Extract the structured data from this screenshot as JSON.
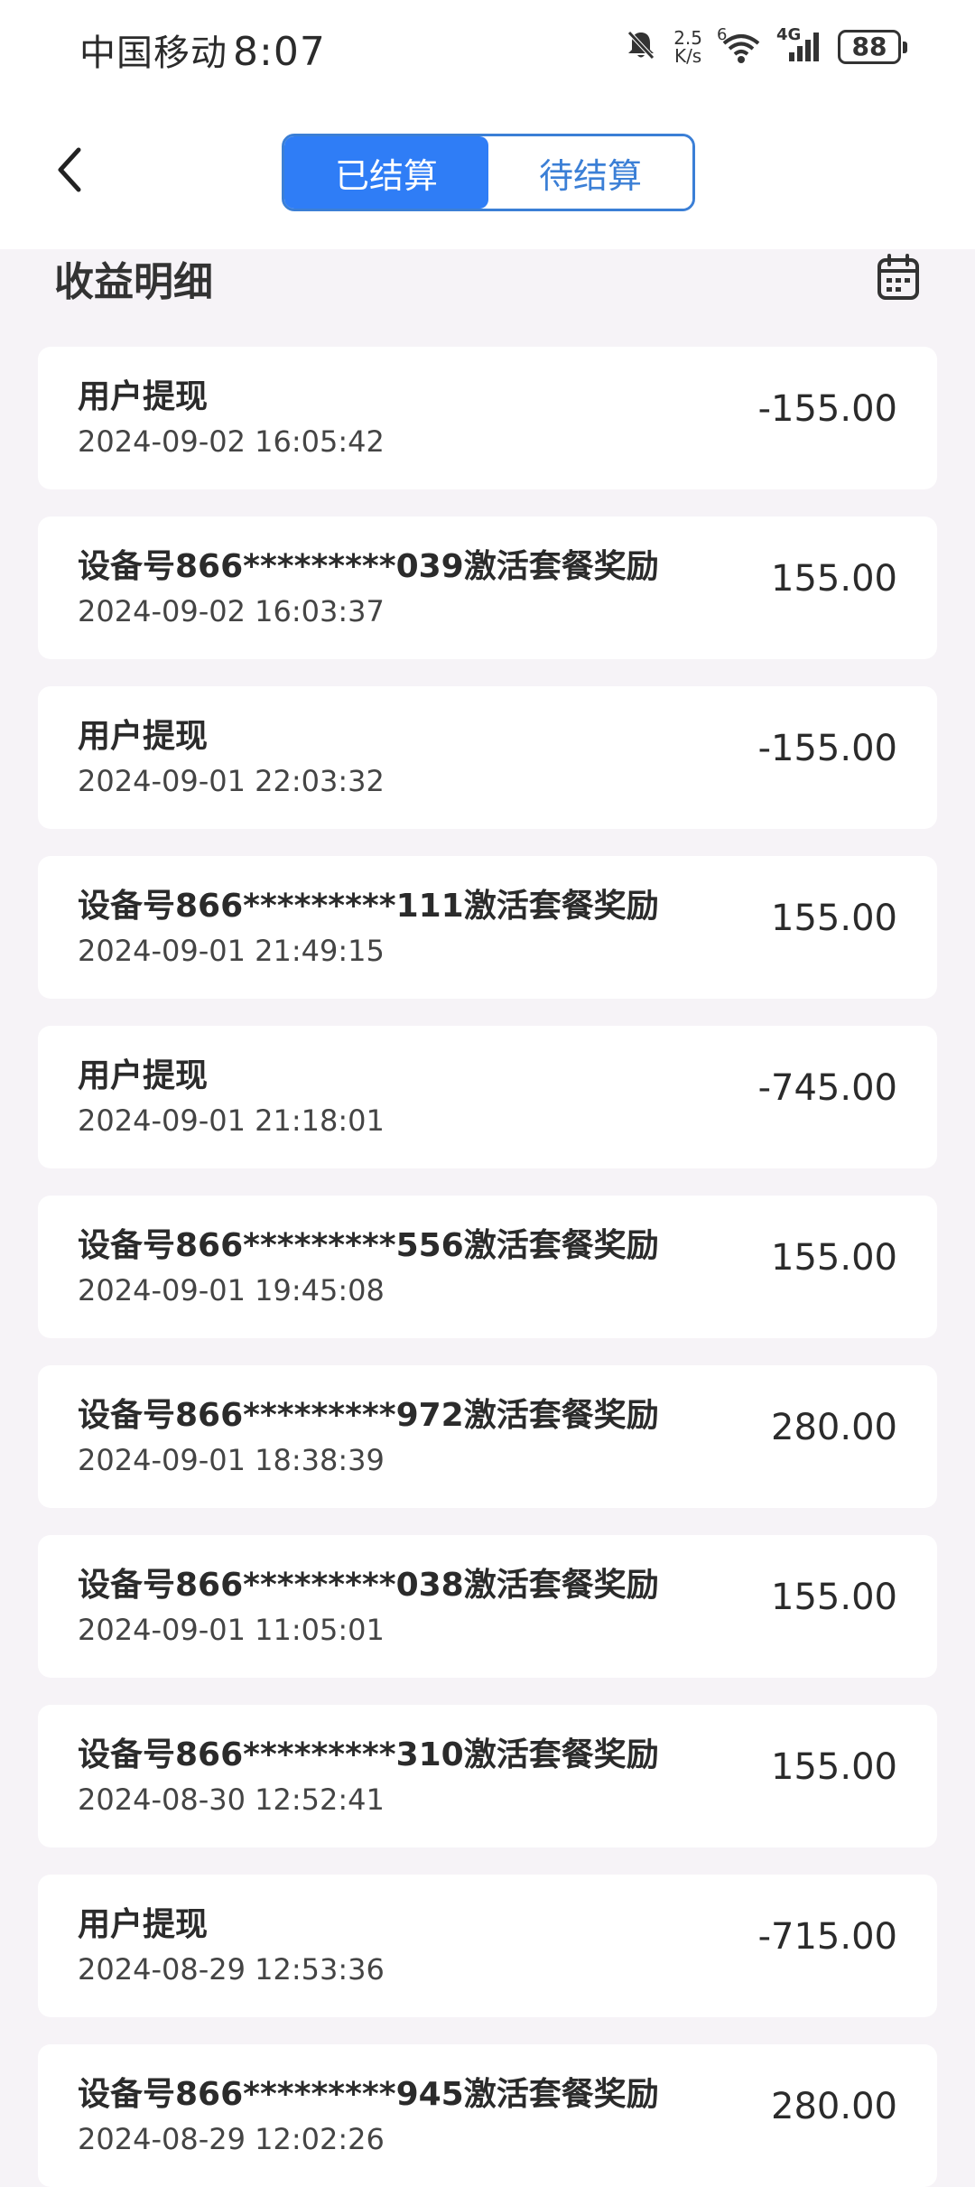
{
  "status_bar": {
    "carrier": "中国移动",
    "time": "8:07",
    "net_speed_value": "2.5",
    "net_speed_unit": "K/s",
    "wifi_badge": "6",
    "cell_badge": "4G",
    "battery": "88"
  },
  "header": {
    "back_icon": "chevron-left-icon",
    "tabs": [
      {
        "label": "已结算",
        "active": true
      },
      {
        "label": "待结算",
        "active": false
      }
    ],
    "accent_color": "#2f7df6"
  },
  "section": {
    "title": "收益明细",
    "calendar_icon": "calendar-icon"
  },
  "records": [
    {
      "title": "用户提现",
      "time": "2024-09-02 16:05:42",
      "amount": "-155.00"
    },
    {
      "title": "设备号866*********039激活套餐奖励",
      "time": "2024-09-02 16:03:37",
      "amount": "155.00"
    },
    {
      "title": "用户提现",
      "time": "2024-09-01 22:03:32",
      "amount": "-155.00"
    },
    {
      "title": "设备号866*********111激活套餐奖励",
      "time": "2024-09-01 21:49:15",
      "amount": "155.00"
    },
    {
      "title": "用户提现",
      "time": "2024-09-01 21:18:01",
      "amount": "-745.00"
    },
    {
      "title": "设备号866*********556激活套餐奖励",
      "time": "2024-09-01 19:45:08",
      "amount": "155.00"
    },
    {
      "title": "设备号866*********972激活套餐奖励",
      "time": "2024-09-01 18:38:39",
      "amount": "280.00"
    },
    {
      "title": "设备号866*********038激活套餐奖励",
      "time": "2024-09-01 11:05:01",
      "amount": "155.00"
    },
    {
      "title": "设备号866*********310激活套餐奖励",
      "time": "2024-08-30 12:52:41",
      "amount": "155.00"
    },
    {
      "title": "用户提现",
      "time": "2024-08-29 12:53:36",
      "amount": "-715.00"
    },
    {
      "title": "设备号866*********945激活套餐奖励",
      "time": "2024-08-29 12:02:26",
      "amount": "280.00"
    }
  ]
}
